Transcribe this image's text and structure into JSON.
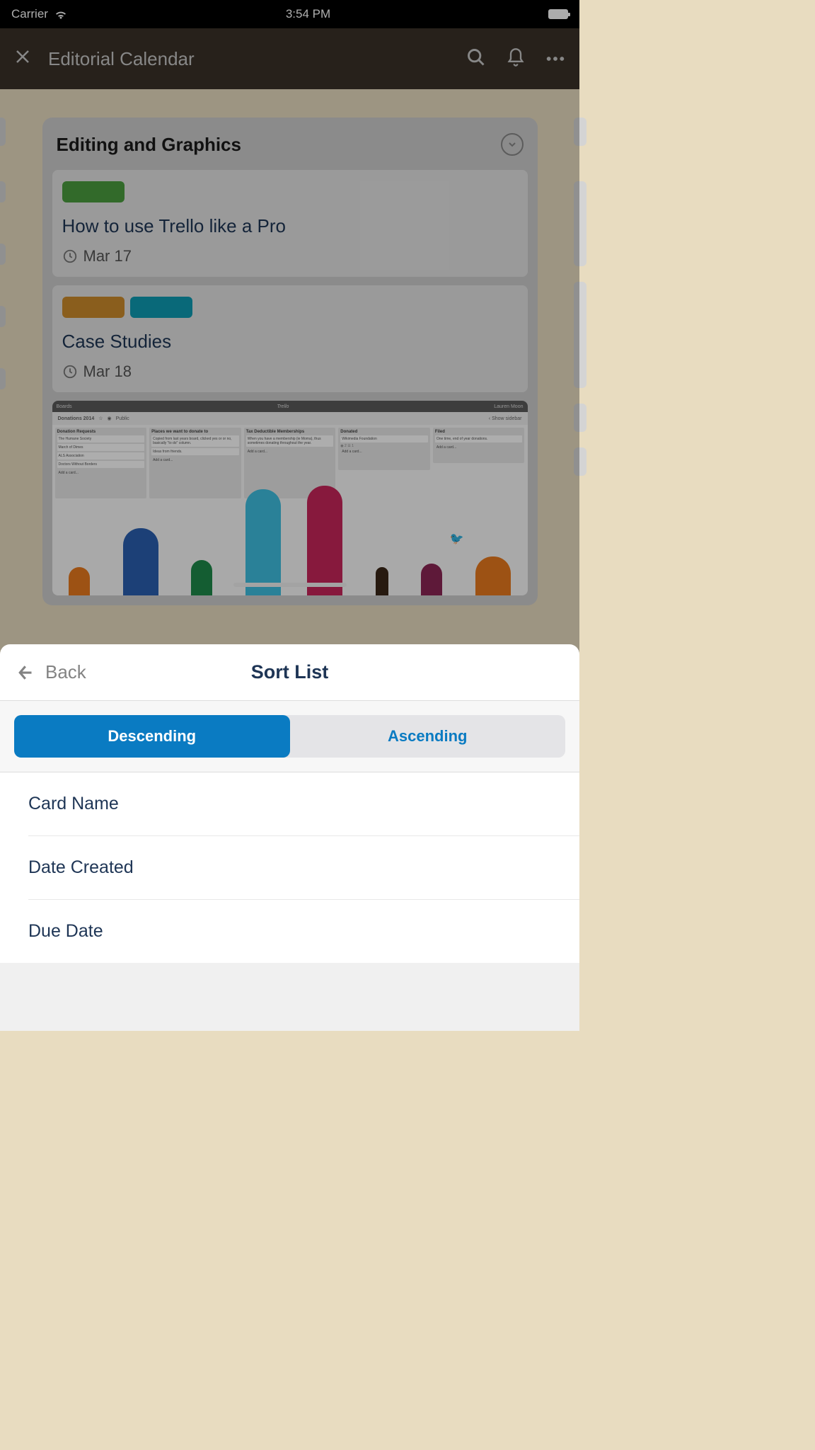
{
  "status_bar": {
    "carrier": "Carrier",
    "time": "3:54 PM"
  },
  "header": {
    "title": "Editorial Calendar"
  },
  "board": {
    "list": {
      "title": "Editing and Graphics",
      "cards": [
        {
          "title": "How to use Trello like a Pro",
          "date": "Mar 17"
        },
        {
          "title": "Case Studies",
          "date": "Mar 18"
        }
      ]
    },
    "mini_board": {
      "title": "Donations 2014",
      "visibility": "Public",
      "show_sidebar": "Show sidebar",
      "app_name": "Trello",
      "boards_label": "Boards",
      "user": "Lauren Moon",
      "add_card": "Add a card...",
      "lists": {
        "l1": {
          "title": "Donation Requests",
          "c1": "The Humane Society",
          "c2": "March of Dimes",
          "c3": "ALS Association",
          "c4": "Doctors Without Borders"
        },
        "l2": {
          "title": "Places we want to donate to",
          "c1": "Copied from last years board, clicked yes or or no, basically \"to do\" column.",
          "c2": "Ideas from friends."
        },
        "l3": {
          "title": "Tax Deductible Memberships",
          "c1": "When you have a membership (ie Moma), thus sometimes donating throughout the year."
        },
        "l4": {
          "title": "Donated",
          "c1": "Wikimedia Foundation"
        },
        "l5": {
          "title": "Filed",
          "c1": "One time, end of year donations."
        }
      }
    }
  },
  "sheet": {
    "back_label": "Back",
    "title": "Sort List",
    "segments": {
      "descending": "Descending",
      "ascending": "Ascending"
    },
    "options": {
      "card_name": "Card Name",
      "date_created": "Date Created",
      "due_date": "Due Date"
    }
  }
}
